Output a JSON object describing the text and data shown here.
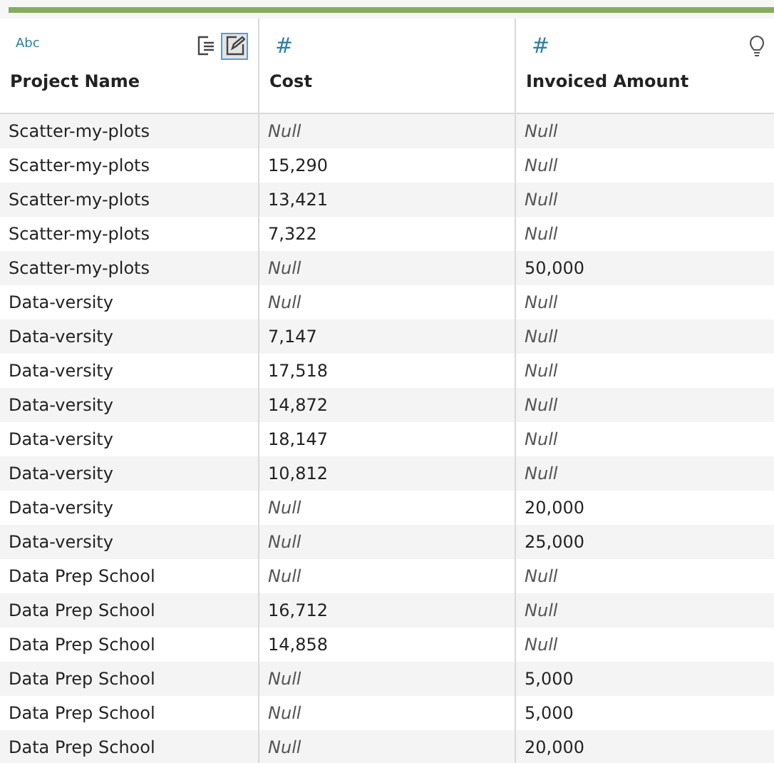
{
  "columns": [
    {
      "type_label": "Abc",
      "name": "Project Name",
      "tools": [
        {
          "kind": "export",
          "selected": false
        },
        {
          "kind": "edit",
          "selected": true
        }
      ]
    },
    {
      "type_label": "#",
      "name": "Cost"
    },
    {
      "type_label": "#",
      "name": "Invoiced Amount",
      "tools": [
        {
          "kind": "bulb",
          "selected": false
        }
      ]
    }
  ],
  "rows": [
    [
      {
        "text": "Scatter-my-plots",
        "null": false
      },
      {
        "text": "Null",
        "null": true
      },
      {
        "text": "Null",
        "null": true
      }
    ],
    [
      {
        "text": "Scatter-my-plots",
        "null": false
      },
      {
        "text": "15,290",
        "null": false
      },
      {
        "text": "Null",
        "null": true
      }
    ],
    [
      {
        "text": "Scatter-my-plots",
        "null": false
      },
      {
        "text": "13,421",
        "null": false
      },
      {
        "text": "Null",
        "null": true
      }
    ],
    [
      {
        "text": "Scatter-my-plots",
        "null": false
      },
      {
        "text": "7,322",
        "null": false
      },
      {
        "text": "Null",
        "null": true
      }
    ],
    [
      {
        "text": "Scatter-my-plots",
        "null": false
      },
      {
        "text": "Null",
        "null": true
      },
      {
        "text": "50,000",
        "null": false
      }
    ],
    [
      {
        "text": "Data-versity",
        "null": false
      },
      {
        "text": "Null",
        "null": true
      },
      {
        "text": "Null",
        "null": true
      }
    ],
    [
      {
        "text": "Data-versity",
        "null": false
      },
      {
        "text": "7,147",
        "null": false
      },
      {
        "text": "Null",
        "null": true
      }
    ],
    [
      {
        "text": "Data-versity",
        "null": false
      },
      {
        "text": "17,518",
        "null": false
      },
      {
        "text": "Null",
        "null": true
      }
    ],
    [
      {
        "text": "Data-versity",
        "null": false
      },
      {
        "text": "14,872",
        "null": false
      },
      {
        "text": "Null",
        "null": true
      }
    ],
    [
      {
        "text": "Data-versity",
        "null": false
      },
      {
        "text": "18,147",
        "null": false
      },
      {
        "text": "Null",
        "null": true
      }
    ],
    [
      {
        "text": "Data-versity",
        "null": false
      },
      {
        "text": "10,812",
        "null": false
      },
      {
        "text": "Null",
        "null": true
      }
    ],
    [
      {
        "text": "Data-versity",
        "null": false
      },
      {
        "text": "Null",
        "null": true
      },
      {
        "text": "20,000",
        "null": false
      }
    ],
    [
      {
        "text": "Data-versity",
        "null": false
      },
      {
        "text": "Null",
        "null": true
      },
      {
        "text": "25,000",
        "null": false
      }
    ],
    [
      {
        "text": "Data Prep School",
        "null": false
      },
      {
        "text": "Null",
        "null": true
      },
      {
        "text": "Null",
        "null": true
      }
    ],
    [
      {
        "text": "Data Prep School",
        "null": false
      },
      {
        "text": "16,712",
        "null": false
      },
      {
        "text": "Null",
        "null": true
      }
    ],
    [
      {
        "text": "Data Prep School",
        "null": false
      },
      {
        "text": "14,858",
        "null": false
      },
      {
        "text": "Null",
        "null": true
      }
    ],
    [
      {
        "text": "Data Prep School",
        "null": false
      },
      {
        "text": "Null",
        "null": true
      },
      {
        "text": "5,000",
        "null": false
      }
    ],
    [
      {
        "text": "Data Prep School",
        "null": false
      },
      {
        "text": "Null",
        "null": true
      },
      {
        "text": "5,000",
        "null": false
      }
    ],
    [
      {
        "text": "Data Prep School",
        "null": false
      },
      {
        "text": "Null",
        "null": true
      },
      {
        "text": "20,000",
        "null": false
      }
    ]
  ]
}
